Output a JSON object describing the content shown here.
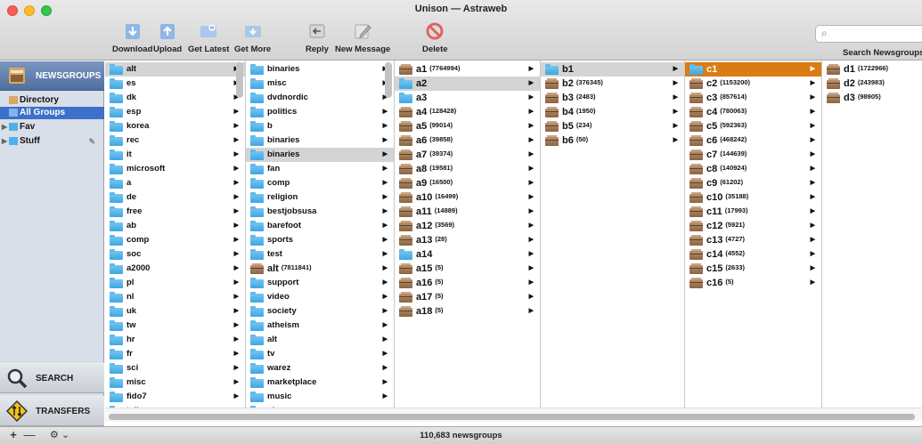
{
  "window": {
    "title": "Unison — Astraweb"
  },
  "toolbar": {
    "download": "Download",
    "upload": "Upload",
    "get_latest": "Get Latest",
    "get_more": "Get More",
    "reply": "Reply",
    "new_message": "New Message",
    "delete": "Delete",
    "search_label": "Search Newsgroups",
    "search_value": ""
  },
  "sidebar": {
    "newsgroups": "NEWSGROUPS",
    "directory": "Directory",
    "all_groups": "All Groups",
    "fav": "Fav",
    "stuff": "Stuff",
    "search": "SEARCH",
    "transfers": "TRANSFERS"
  },
  "columns": [
    {
      "items": [
        {
          "name": "alt",
          "icon": "folder",
          "selected": "gray"
        },
        {
          "name": "es",
          "icon": "folder"
        },
        {
          "name": "dk",
          "icon": "folder"
        },
        {
          "name": "esp",
          "icon": "folder"
        },
        {
          "name": "korea",
          "icon": "folder"
        },
        {
          "name": "rec",
          "icon": "folder"
        },
        {
          "name": "it",
          "icon": "folder"
        },
        {
          "name": "microsoft",
          "icon": "folder"
        },
        {
          "name": "a",
          "icon": "folder"
        },
        {
          "name": "de",
          "icon": "folder"
        },
        {
          "name": "free",
          "icon": "folder"
        },
        {
          "name": "ab",
          "icon": "folder"
        },
        {
          "name": "comp",
          "icon": "folder"
        },
        {
          "name": "soc",
          "icon": "folder"
        },
        {
          "name": "a2000",
          "icon": "folder"
        },
        {
          "name": "pl",
          "icon": "folder"
        },
        {
          "name": "nl",
          "icon": "folder"
        },
        {
          "name": "uk",
          "icon": "folder"
        },
        {
          "name": "tw",
          "icon": "folder"
        },
        {
          "name": "hr",
          "icon": "folder"
        },
        {
          "name": "fr",
          "icon": "folder"
        },
        {
          "name": "sci",
          "icon": "folder"
        },
        {
          "name": "misc",
          "icon": "folder"
        },
        {
          "name": "fido7",
          "icon": "folder"
        },
        {
          "name": "talk",
          "icon": "folder"
        }
      ]
    },
    {
      "items": [
        {
          "name": "binaries",
          "icon": "folder"
        },
        {
          "name": "misc",
          "icon": "folder"
        },
        {
          "name": "dvdnordic",
          "icon": "folder"
        },
        {
          "name": "politics",
          "icon": "folder"
        },
        {
          "name": "b",
          "icon": "folder"
        },
        {
          "name": "binaries",
          "icon": "folder"
        },
        {
          "name": "binaries",
          "icon": "folder",
          "selected": "gray"
        },
        {
          "name": "fan",
          "icon": "folder"
        },
        {
          "name": "comp",
          "icon": "folder"
        },
        {
          "name": "religion",
          "icon": "folder"
        },
        {
          "name": "bestjobsusa",
          "icon": "folder"
        },
        {
          "name": "barefoot",
          "icon": "folder"
        },
        {
          "name": "sports",
          "icon": "folder"
        },
        {
          "name": "test",
          "icon": "folder"
        },
        {
          "name": "alt",
          "count": "(7811841)",
          "icon": "box"
        },
        {
          "name": "support",
          "icon": "folder"
        },
        {
          "name": "video",
          "icon": "folder"
        },
        {
          "name": "society",
          "icon": "folder"
        },
        {
          "name": "atheism",
          "icon": "folder"
        },
        {
          "name": "alt",
          "icon": "folder"
        },
        {
          "name": "tv",
          "icon": "folder"
        },
        {
          "name": "warez",
          "icon": "folder"
        },
        {
          "name": "marketplace",
          "icon": "folder"
        },
        {
          "name": "music",
          "icon": "folder"
        },
        {
          "name": "pl",
          "icon": "folder"
        }
      ]
    },
    {
      "items": [
        {
          "name": "a1",
          "count": "(7764994)",
          "icon": "box"
        },
        {
          "name": "a2",
          "icon": "folder",
          "selected": "gray"
        },
        {
          "name": "a3",
          "icon": "folder"
        },
        {
          "name": "a4",
          "count": "(128428)",
          "icon": "box"
        },
        {
          "name": "a5",
          "count": "(99014)",
          "icon": "box"
        },
        {
          "name": "a6",
          "count": "(39858)",
          "icon": "box"
        },
        {
          "name": "a7",
          "count": "(39374)",
          "icon": "box"
        },
        {
          "name": "a8",
          "count": "(19581)",
          "icon": "box"
        },
        {
          "name": "a9",
          "count": "(16500)",
          "icon": "box"
        },
        {
          "name": "a10",
          "count": "(16499)",
          "icon": "box"
        },
        {
          "name": "a11",
          "count": "(14889)",
          "icon": "box"
        },
        {
          "name": "a12",
          "count": "(3569)",
          "icon": "box"
        },
        {
          "name": "a13",
          "count": "(28)",
          "icon": "box"
        },
        {
          "name": "a14",
          "icon": "folder"
        },
        {
          "name": "a15",
          "count": "(5)",
          "icon": "box"
        },
        {
          "name": "a16",
          "count": "(5)",
          "icon": "box"
        },
        {
          "name": "a17",
          "count": "(5)",
          "icon": "box"
        },
        {
          "name": "a18",
          "count": "(5)",
          "icon": "box"
        }
      ]
    },
    {
      "items": [
        {
          "name": "b1",
          "icon": "folder",
          "selected": "gray"
        },
        {
          "name": "b2",
          "count": "(376345)",
          "icon": "box"
        },
        {
          "name": "b3",
          "count": "(2483)",
          "icon": "box"
        },
        {
          "name": "b4",
          "count": "(1950)",
          "icon": "box"
        },
        {
          "name": "b5",
          "count": "(234)",
          "icon": "box"
        },
        {
          "name": "b6",
          "count": "(50)",
          "icon": "box"
        }
      ]
    },
    {
      "items": [
        {
          "name": "c1",
          "icon": "folder",
          "selected": "orange"
        },
        {
          "name": "c2",
          "count": "(1153200)",
          "icon": "box"
        },
        {
          "name": "c3",
          "count": "(857614)",
          "icon": "box"
        },
        {
          "name": "c4",
          "count": "(780063)",
          "icon": "box"
        },
        {
          "name": "c5",
          "count": "(592363)",
          "icon": "box"
        },
        {
          "name": "c6",
          "count": "(468242)",
          "icon": "box"
        },
        {
          "name": "c7",
          "count": "(144639)",
          "icon": "box"
        },
        {
          "name": "c8",
          "count": "(140924)",
          "icon": "box"
        },
        {
          "name": "c9",
          "count": "(61202)",
          "icon": "box"
        },
        {
          "name": "c10",
          "count": "(35188)",
          "icon": "box"
        },
        {
          "name": "c11",
          "count": "(17993)",
          "icon": "box"
        },
        {
          "name": "c12",
          "count": "(5921)",
          "icon": "box"
        },
        {
          "name": "c13",
          "count": "(4727)",
          "icon": "box"
        },
        {
          "name": "c14",
          "count": "(4552)",
          "icon": "box"
        },
        {
          "name": "c15",
          "count": "(2633)",
          "icon": "box"
        },
        {
          "name": "c16",
          "count": "(5)",
          "icon": "box"
        }
      ]
    },
    {
      "items": [
        {
          "name": "d1",
          "count": "(1722966)",
          "icon": "box"
        },
        {
          "name": "d2",
          "count": "(243983)",
          "icon": "box"
        },
        {
          "name": "d3",
          "count": "(98905)",
          "icon": "box"
        }
      ]
    }
  ],
  "status": {
    "text": "110,683 newsgroups",
    "add": "+",
    "remove": "—",
    "gear": "⚙ ⌄"
  },
  "colors": {
    "selection_orange": "#dc7a14",
    "selection_gray": "#d4d4d4",
    "sidebar_selected": "#3d70c8",
    "folder_blue": "#3ea6e2"
  }
}
